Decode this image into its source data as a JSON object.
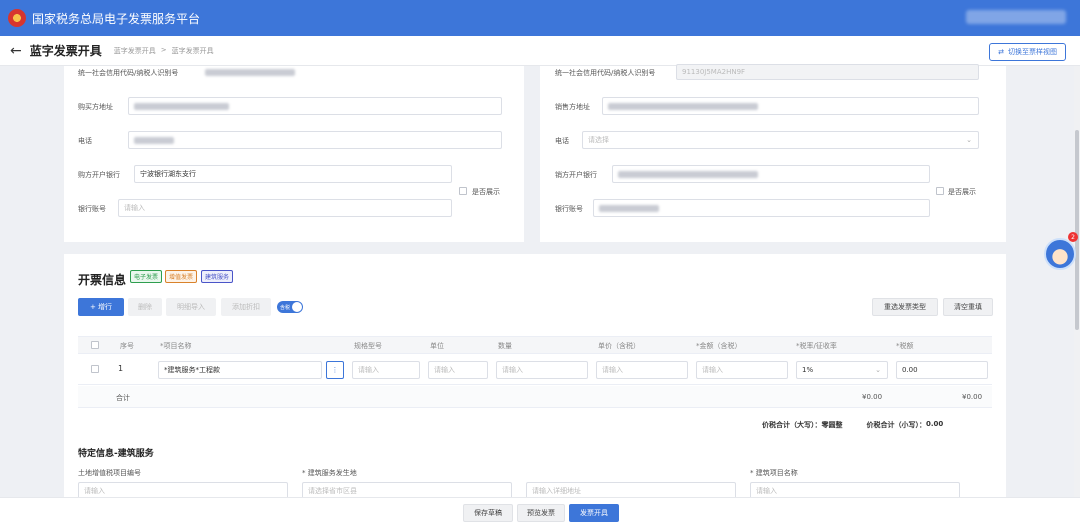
{
  "header": {
    "platform_title": "国家税务总局电子发票服务平台"
  },
  "subheader": {
    "back_icon": "←",
    "page_title": "蓝字发票开具",
    "breadcrumb": [
      "蓝字发票开具",
      ">",
      "蓝字发票开具"
    ],
    "switch_label": "切换至票样视图"
  },
  "buyer": {
    "taxid_label": "统一社会信用代码/纳税人识别号",
    "address_label": "购买方地址",
    "phone_label": "电话",
    "bank_label": "购方开户银行",
    "bank_value": "宁波银行湖东支行",
    "account_label": "银行账号",
    "account_placeholder": "请输入",
    "show_label": "是否展示"
  },
  "seller": {
    "taxid_label": "统一社会信用代码/纳税人识别号",
    "taxid_value": "91130J5MA2HN9F",
    "address_label": "销售方地址",
    "phone_label": "电话",
    "phone_placeholder": "请选择",
    "bank_label": "销方开户银行",
    "account_label": "银行账号",
    "show_label": "是否展示"
  },
  "invoice": {
    "title": "开票信息",
    "tags": [
      {
        "label": "电子发票",
        "color": "#2e9e4f"
      },
      {
        "label": "增值发票",
        "color": "#d9822b"
      },
      {
        "label": "建筑服务",
        "color": "#4a55c8"
      }
    ],
    "buttons": {
      "add_row": "+ 增行",
      "delete": "删除",
      "batch_import": "明细导入",
      "add_discount": "添加折扣",
      "tax_incl": "含税"
    },
    "right_buttons": {
      "reselect": "重选发票类型",
      "clear": "清空重填"
    },
    "columns": [
      "序号",
      "*项目名称",
      "规格型号",
      "单位",
      "数量",
      "单价（含税）",
      "*金额（含税）",
      "*税率/征收率",
      "*税额"
    ],
    "row": {
      "index": "1",
      "item_name": "*建筑服务*工程款",
      "placeholder": "请输入",
      "tax_rate": "1%",
      "tax_amount": "0.00"
    },
    "total_label": "合计",
    "total_amount": "¥0.00",
    "total_tax": "¥0.00",
    "total_upper_label": "价税合计（大写）：",
    "total_upper_value": "零圆整",
    "total_lower_label": "价税合计（小写）：",
    "total_lower_value": "0.00"
  },
  "special": {
    "title": "特定信息-建筑服务",
    "land_label": "土地增值税项目编号",
    "place_label": "* 建筑服务发生地",
    "project_label": "* 建筑项目名称",
    "placeholder": "请输入",
    "region_placeholder": "请选择省市区县",
    "address_placeholder": "请输入详细地址"
  },
  "footer": {
    "save_draft": "保存草稿",
    "preview": "预览发票",
    "issue": "发票开具"
  },
  "assistant": {
    "badge_count": "2"
  },
  "colors": {
    "brand": "#3d76d9"
  }
}
